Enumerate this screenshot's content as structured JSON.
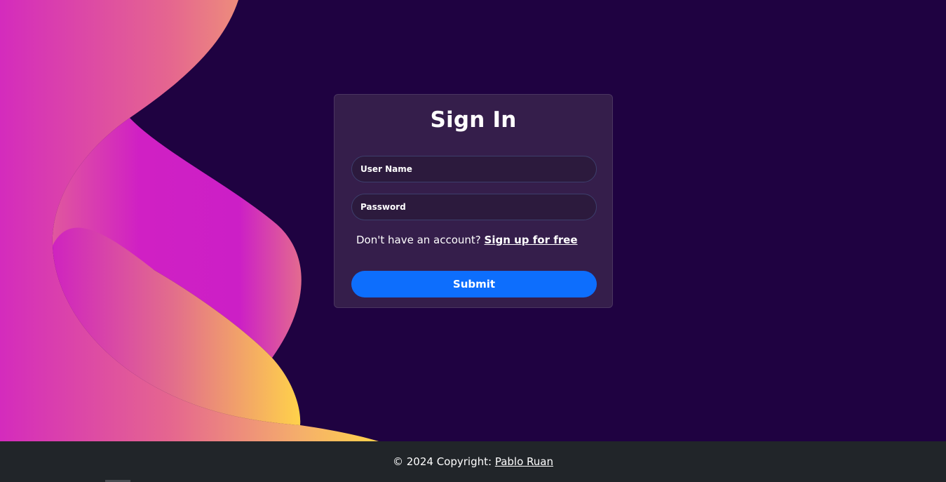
{
  "colors": {
    "page_background": "#1f0241",
    "card_background": "#351e4b",
    "accent_button": "#0d6efd",
    "footer_background": "#212529",
    "wave_pink": "#d42bbd",
    "wave_orange": "#ef8f72",
    "wave_yellow": "#ffd24a"
  },
  "login": {
    "title": "Sign In",
    "username_placeholder": "User Name",
    "password_placeholder": "Password",
    "signup_prompt": "Don't have an account? ",
    "signup_link": "Sign up for free",
    "submit_label": "Submit"
  },
  "footer": {
    "copyright_text": "© 2024 Copyright: ",
    "author_link": "Pablo Ruan"
  }
}
